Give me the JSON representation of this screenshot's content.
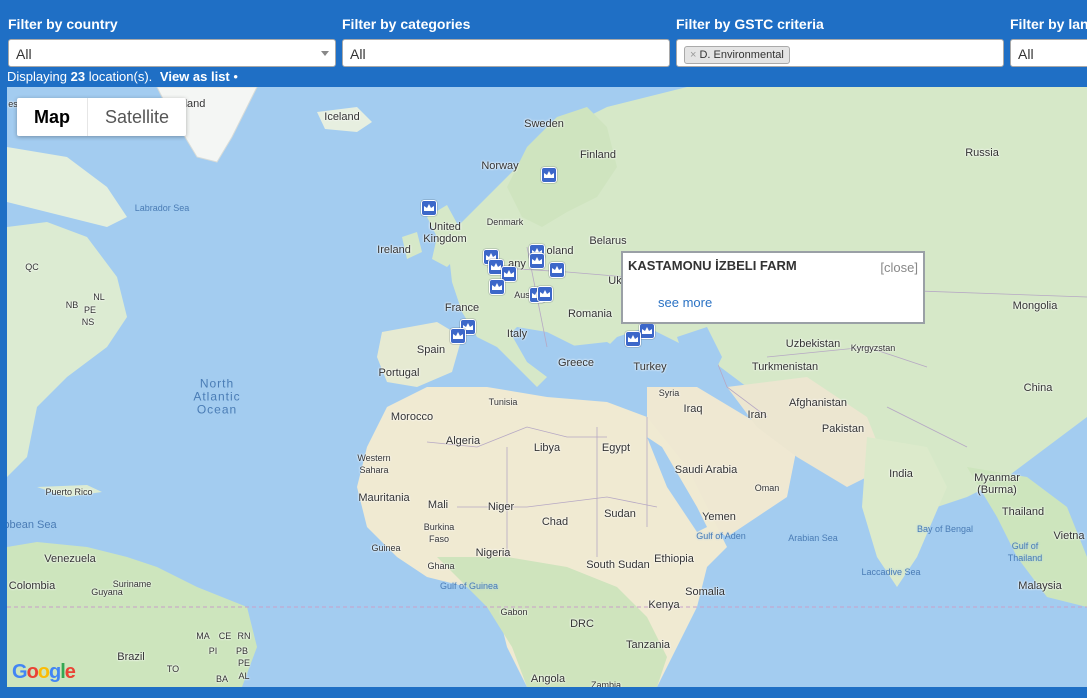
{
  "filters": [
    {
      "label": "Filter by country",
      "value": "All",
      "has_caret": true
    },
    {
      "label": "Filter by categories",
      "value": "All"
    },
    {
      "label": "Filter by GSTC criteria",
      "chip": "D. Environmental",
      "chip_remove": "×"
    },
    {
      "label": "Filter by landscape",
      "value": "All"
    }
  ],
  "status": {
    "prefix": "Displaying",
    "count": "23",
    "suffix": "location(s).",
    "view_link": "View as list",
    "bullet": "•"
  },
  "map": {
    "type_control": {
      "map": "Map",
      "satellite": "Satellite",
      "active": "Map"
    },
    "colors": {
      "water": "#a3ccf0",
      "land": "#dcebd2",
      "desert": "#f2eedc",
      "border": "#b6a8c4",
      "marker": "#3c67c9",
      "equator": "#c8a0c8"
    },
    "labels": {
      "greenland": "land",
      "iceland": "Iceland",
      "sweden": "Sweden",
      "finland": "Finland",
      "russia": "Russia",
      "norway": "Norway",
      "labrador_sea": "Labrador Sea",
      "denmark": "Denmark",
      "uk": [
        "United",
        "Kingdom"
      ],
      "ireland": "Ireland",
      "germany": "any",
      "poland": "oland",
      "belarus": "Belarus",
      "ukraine": "Uk",
      "austria": "Aus",
      "france": "France",
      "romania": "Romania",
      "mongolia": "Mongolia",
      "italy": "Italy",
      "spain": "Spain",
      "portugal": "Portugal",
      "greece": "Greece",
      "turkey": "Turkey",
      "uzbekistan": "Uzbekistan",
      "kyrgyzstan": "Kyrgyzstan",
      "turkmenistan": "Turkmenistan",
      "china": "China",
      "north_atlantic": [
        "North",
        "Atlantic",
        "Ocean"
      ],
      "tunisia": "Tunisia",
      "syria": "Syria",
      "iraq": "Iraq",
      "iran": "Iran",
      "afghanistan": "Afghanistan",
      "pakistan": "Pakistan",
      "morocco": "Morocco",
      "algeria": "Algeria",
      "libya": "Libya",
      "egypt": "Egypt",
      "western_sahara": [
        "Western",
        "Sahara"
      ],
      "saudi_arabia": "Saudi Arabia",
      "india": "India",
      "myanmar": [
        "Myanmar",
        "(Burma)"
      ],
      "oman": "Oman",
      "puerto_rico": "Puerto Rico",
      "mauritania": "Mauritania",
      "mali": "Mali",
      "niger": "Niger",
      "chad": "Chad",
      "sudan": "Sudan",
      "yemen": "Yemen",
      "thailand": "Thailand",
      "caribbean_sea": "bbean Sea",
      "burkina_faso": [
        "Burkina",
        "Faso"
      ],
      "gulf_of_aden": "Gulf of Aden",
      "arabian_sea": "Arabian Sea",
      "bay_of_bengal": "Bay of Bengal",
      "vietnam": "Vietna",
      "venezuela": "Venezuela",
      "guinea": "Guinea",
      "nigeria": "Nigeria",
      "ethiopia": "Ethiopia",
      "gulf_of_thailand": [
        "Gulf of",
        "Thailand"
      ],
      "colombia": "Colombia",
      "suriname": "Suriname",
      "guyana": "Guyana",
      "ghana": "Ghana",
      "south_sudan": "South Sudan",
      "laccadive_sea": "Laccadive Sea",
      "gulf_of_guinea": "Gulf of Guinea",
      "somalia": "Somalia",
      "malaysia": "Malaysia",
      "gabon": "Gabon",
      "kenya": "Kenya",
      "drc": "DRC",
      "brazil": "Brazil",
      "tanzania": "Tanzania",
      "angola": "Angola",
      "zambia": "Zambia",
      "qc": "QC",
      "nb": "NB",
      "ns": "NS",
      "pe": "PE",
      "nl": "NL",
      "es": "es",
      "ma": "MA",
      "ce": "CE",
      "rn": "RN",
      "pi": "PI",
      "pb": "PB",
      "to": "TO",
      "pe2": "PE",
      "ba": "BA",
      "al": "AL"
    },
    "popup": {
      "title": "KASTAMONU İZBELI FARM",
      "close": "[close]",
      "link": "see more"
    },
    "logo": [
      "G",
      "o",
      "o",
      "g",
      "l",
      "e"
    ]
  }
}
